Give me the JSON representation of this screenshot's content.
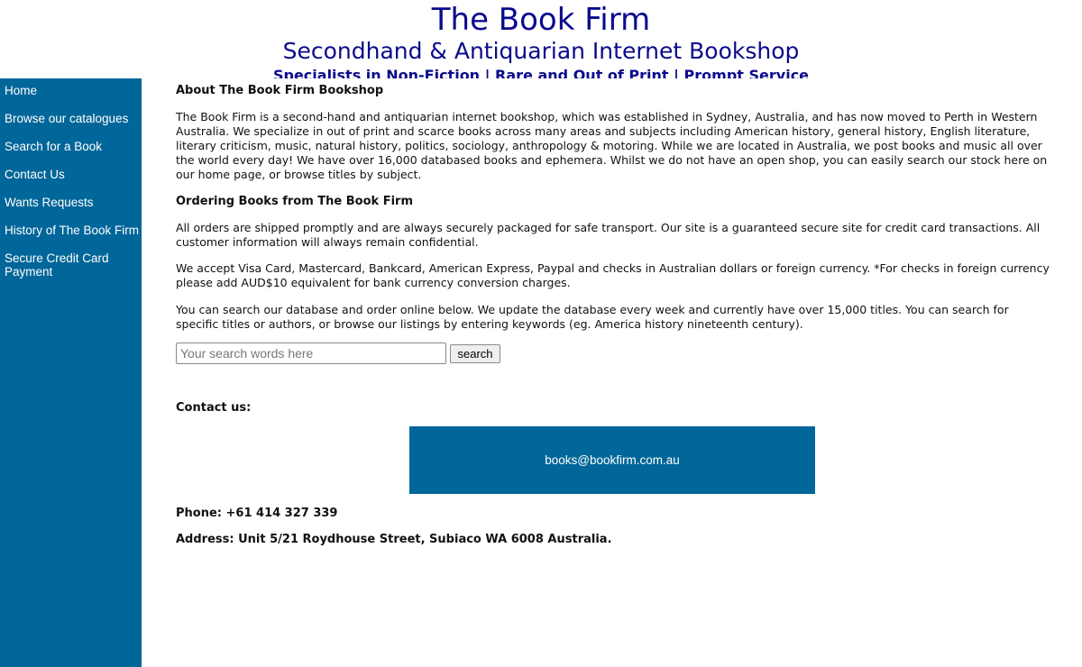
{
  "header": {
    "title": "The Book Firm",
    "subtitle": "Secondhand & Antiquarian Internet Bookshop",
    "tagline": "Specialists in Non-Fiction | Rare and Out of Print | Prompt Service"
  },
  "sidebar": {
    "items": [
      {
        "label": "Home"
      },
      {
        "label": "Browse our catalogues"
      },
      {
        "label": "Search for a Book"
      },
      {
        "label": "Contact Us"
      },
      {
        "label": "Wants Requests"
      },
      {
        "label": "History of The Book Firm"
      },
      {
        "label": "Secure Credit Card Payment"
      }
    ]
  },
  "about": {
    "heading": "About The Book Firm Bookshop",
    "text": "The Book Firm is a second-hand and antiquarian internet bookshop, which was established in Sydney, Australia, and has now moved to Perth in Western Australia. We specialize in out of print and scarce books across many areas and subjects including American history, general history, English literature, literary criticism, music, natural history, politics, sociology, anthropology & motoring. While we are located in Australia, we post books and music all over the world every day! We have over 16,000 databased books and ephemera. Whilst we do not have an open shop, you can easily search our stock here on our home page, or browse titles by subject."
  },
  "ordering": {
    "heading": "Ordering Books from The Book Firm",
    "paragraphs": [
      "All orders are shipped promptly and are always securely packaged for safe transport. Our site is a guaranteed secure site for credit card transactions. All customer information will always remain confidential.",
      "We accept Visa Card, Mastercard, Bankcard, American Express, Paypal and checks in Australian dollars or foreign currency. *For checks in foreign currency please add AUD$10 equivalent for bank currency conversion charges.",
      "You can search our database and order online below. We update the database every week and currently have over 15,000 titles. You can search for specific titles or authors, or browse our listings by entering keywords (eg. America history nineteenth century)."
    ]
  },
  "search": {
    "placeholder": "Your search words here",
    "button_label": "search"
  },
  "contact": {
    "heading": "Contact us:",
    "email": "books@bookfirm.com.au",
    "phone": "Phone: +61 414 327 339",
    "address": "Address: Unit 5/21 Roydhouse Street, Subiaco WA 6008 Australia."
  },
  "colors": {
    "sidebar_bg": "#016699",
    "header_text": "#0a0a8c"
  }
}
